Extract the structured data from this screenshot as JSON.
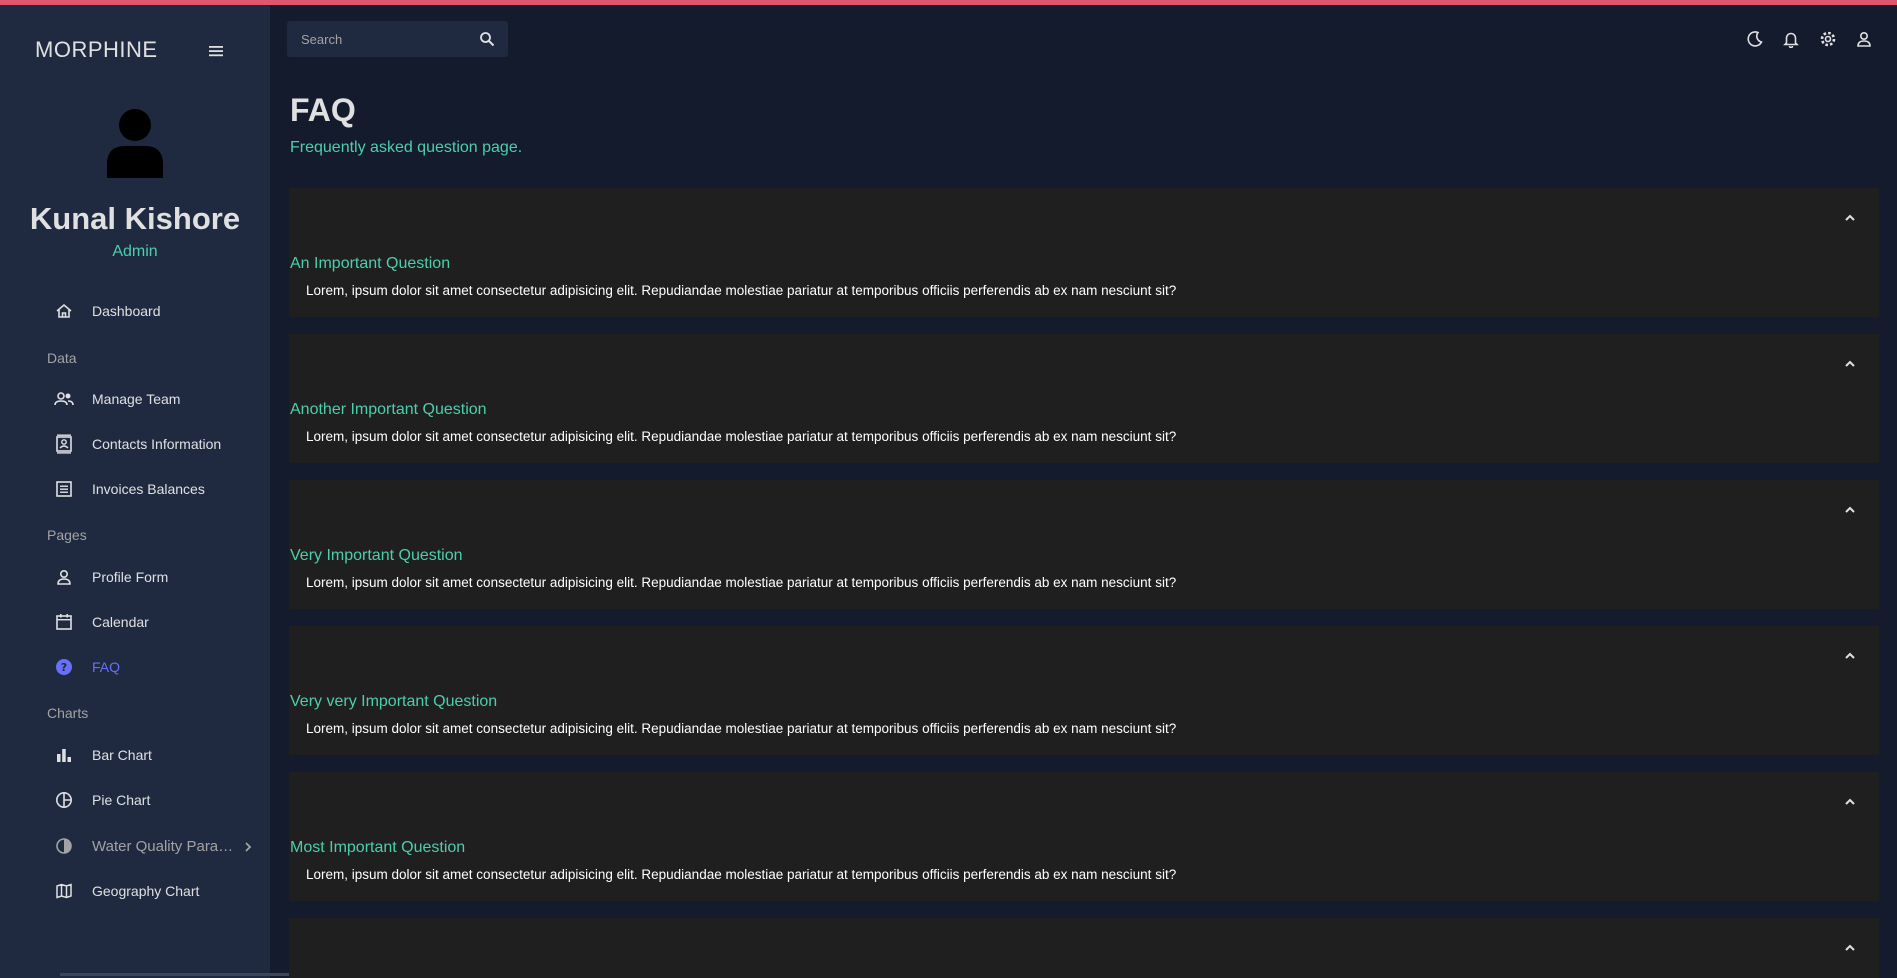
{
  "brand": "MORPHINE",
  "search": {
    "placeholder": "Search"
  },
  "user": {
    "name": "Kunal Kishore",
    "role": "Admin"
  },
  "sidebar": {
    "dashboard": "Dashboard",
    "sections": {
      "data": "Data",
      "pages": "Pages",
      "charts": "Charts"
    },
    "items": {
      "manage_team": "Manage Team",
      "contacts": "Contacts Information",
      "invoices": "Invoices Balances",
      "profile_form": "Profile Form",
      "calendar": "Calendar",
      "faq": "FAQ",
      "bar_chart": "Bar Chart",
      "pie_chart": "Pie Chart",
      "water_quality": "Water Quality Parameters",
      "geography_chart": "Geography Chart"
    },
    "active_item": "faq"
  },
  "header": {
    "title": "FAQ",
    "subtitle": "Frequently asked question page."
  },
  "faq": [
    {
      "question": "An Important Question",
      "answer": "Lorem, ipsum dolor sit amet consectetur adipisicing elit. Repudiandae molestiae pariatur at temporibus officiis perferendis ab ex nam nesciunt sit?"
    },
    {
      "question": "Another Important Question",
      "answer": "Lorem, ipsum dolor sit amet consectetur adipisicing elit. Repudiandae molestiae pariatur at temporibus officiis perferendis ab ex nam nesciunt sit?"
    },
    {
      "question": "Very Important Question",
      "answer": "Lorem, ipsum dolor sit amet consectetur adipisicing elit. Repudiandae molestiae pariatur at temporibus officiis perferendis ab ex nam nesciunt sit?"
    },
    {
      "question": "Very very Important Question",
      "answer": "Lorem, ipsum dolor sit amet consectetur adipisicing elit. Repudiandae molestiae pariatur at temporibus officiis perferendis ab ex nam nesciunt sit?"
    },
    {
      "question": "Most Important Question",
      "answer": "Lorem, ipsum dolor sit amet consectetur adipisicing elit. Repudiandae molestiae pariatur at temporibus officiis perferendis ab ex nam nesciunt sit?"
    },
    {
      "question": "",
      "answer": ""
    }
  ],
  "icons": {
    "menu": "hamburger-icon",
    "search": "search-icon",
    "theme": "moon-icon",
    "notifications": "bell-icon",
    "settings": "gear-icon",
    "account": "person-icon"
  },
  "colors": {
    "background": "#141b2d",
    "sidebar": "#1f2a40",
    "accent_green": "#4cceac",
    "accent_active": "#6870fa",
    "top_bar": "#e0566d",
    "faq_card": "#1f1f1f"
  }
}
